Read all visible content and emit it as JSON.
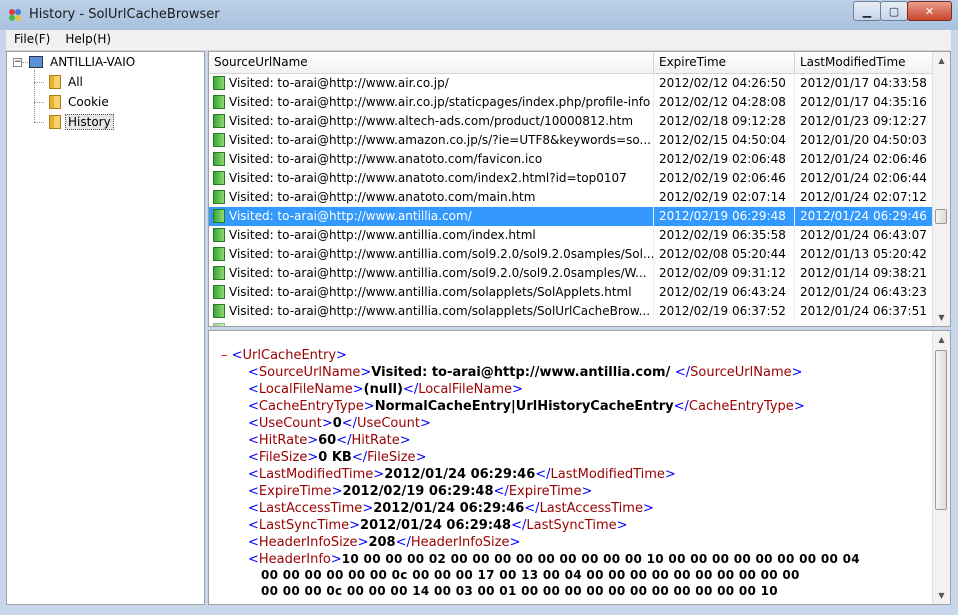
{
  "window": {
    "title": "History - SolUrlCacheBrowser",
    "minimize": "0",
    "maximize": "1",
    "close": "r"
  },
  "menu": {
    "file": "File(F)",
    "help": "Help(H)"
  },
  "tree": {
    "root": "ANTILLIA-VAIO",
    "root_toggle": "−",
    "items": [
      {
        "label": "All"
      },
      {
        "label": "Cookie"
      },
      {
        "label": "History"
      }
    ]
  },
  "list": {
    "columns": [
      "SourceUrlName",
      "ExpireTime",
      "LastModifiedTime"
    ],
    "rows": [
      {
        "url": "Visited: to-arai@http://www.air.co.jp/",
        "expire": "2012/02/12 04:26:50",
        "modified": "2012/01/17 04:33:58"
      },
      {
        "url": "Visited: to-arai@http://www.air.co.jp/staticpages/index.php/profile-info",
        "expire": "2012/02/12 04:28:08",
        "modified": "2012/01/17 04:35:16"
      },
      {
        "url": "Visited: to-arai@http://www.altech-ads.com/product/10000812.htm",
        "expire": "2012/02/18 09:12:28",
        "modified": "2012/01/23 09:12:27"
      },
      {
        "url": "Visited: to-arai@http://www.amazon.co.jp/s/?ie=UTF8&keywords=so...",
        "expire": "2012/02/15 04:50:04",
        "modified": "2012/01/20 04:50:03"
      },
      {
        "url": "Visited: to-arai@http://www.anatoto.com/favicon.ico",
        "expire": "2012/02/19 02:06:48",
        "modified": "2012/01/24 02:06:46"
      },
      {
        "url": "Visited: to-arai@http://www.anatoto.com/index2.html?id=top0107",
        "expire": "2012/02/19 02:06:46",
        "modified": "2012/01/24 02:06:44"
      },
      {
        "url": "Visited: to-arai@http://www.anatoto.com/main.htm",
        "expire": "2012/02/19 02:07:14",
        "modified": "2012/01/24 02:07:12"
      },
      {
        "url": "Visited: to-arai@http://www.antillia.com/",
        "expire": "2012/02/19 06:29:48",
        "modified": "2012/01/24 06:29:46"
      },
      {
        "url": "Visited: to-arai@http://www.antillia.com/index.html",
        "expire": "2012/02/19 06:35:58",
        "modified": "2012/01/24 06:43:07"
      },
      {
        "url": "Visited: to-arai@http://www.antillia.com/sol9.2.0/sol9.2.0samples/Sol...",
        "expire": "2012/02/08 05:20:44",
        "modified": "2012/01/13 05:20:42"
      },
      {
        "url": "Visited: to-arai@http://www.antillia.com/sol9.2.0/sol9.2.0samples/W...",
        "expire": "2012/02/09 09:31:12",
        "modified": "2012/01/14 09:38:21"
      },
      {
        "url": "Visited: to-arai@http://www.antillia.com/solapplets/SolApplets.html",
        "expire": "2012/02/19 06:43:24",
        "modified": "2012/01/24 06:43:23"
      },
      {
        "url": "Visited: to-arai@http://www.antillia.com/solapplets/SolUrlCacheBrow...",
        "expire": "2012/02/19 06:37:52",
        "modified": "2012/01/24 06:37:51"
      }
    ],
    "selected_row": 7
  },
  "detail": {
    "root_tag": "UrlCacheEntry",
    "fields": [
      {
        "tag": "SourceUrlName",
        "value": "Visited: to-arai@http://www.antillia.com/ "
      },
      {
        "tag": "LocalFileName",
        "value": "(null)"
      },
      {
        "tag": "CacheEntryType",
        "value": "NormalCacheEntry|UrlHistoryCacheEntry"
      },
      {
        "tag": "UseCount",
        "value": "0"
      },
      {
        "tag": "HitRate",
        "value": "60"
      },
      {
        "tag": "FileSize",
        "value": "0 KB"
      },
      {
        "tag": "LastModifiedTime",
        "value": "2012/01/24 06:29:46"
      },
      {
        "tag": "ExpireTime",
        "value": "2012/02/19 06:29:48"
      },
      {
        "tag": "LastAccessTime",
        "value": "2012/01/24 06:29:46"
      },
      {
        "tag": "LastSyncTime",
        "value": "2012/01/24 06:29:48"
      },
      {
        "tag": "HeaderInfoSize",
        "value": "208"
      }
    ],
    "header_info_tag": "HeaderInfo",
    "header_info_lines": [
      "10 00 00 00 02 00 00 00 00 00 00 00 00 00 10 00 00 00 00 00 00 00 00 04",
      "00 00 00 00 00 00 0c 00 00 00 17 00 13 00 04 00 00 00 00 00 00 00 00 00 00",
      "00 00 00 0c 00 00 00 14 00 03 00 01 00 00 00 00 00 00 00 00 00 00 00 10"
    ]
  }
}
